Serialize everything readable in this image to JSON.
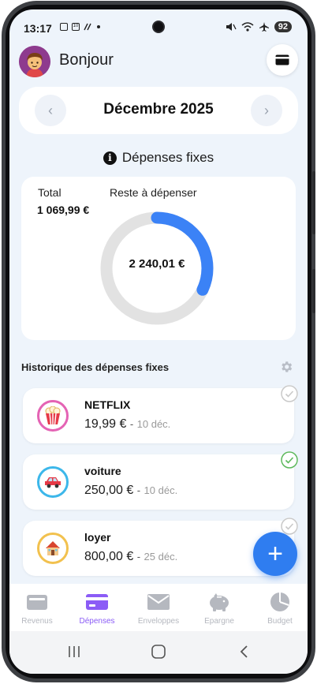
{
  "status_bar": {
    "time": "13:17",
    "mini_box_label": "10",
    "battery": "92"
  },
  "header": {
    "greeting": "Bonjour"
  },
  "month_selector": {
    "month": "Décembre 2025",
    "prev_glyph": "‹",
    "next_glyph": "›"
  },
  "section": {
    "info_glyph": "i",
    "title": "Dépenses fixes"
  },
  "summary": {
    "total_label": "Total",
    "total_value": "1 069,99 €",
    "remaining_label": "Reste à dépenser",
    "remaining_value": "2 240,01 €",
    "remaining_fraction": 0.32,
    "accent_color": "#3b82f6",
    "track_color": "#e2e2e2"
  },
  "history": {
    "title": "Historique des dépenses fixes",
    "items": [
      {
        "name": "NETFLIX",
        "amount": "19,99 €",
        "separator": "-",
        "date": "10 déc.",
        "icon": "popcorn-icon",
        "ring_color": "#e463b4",
        "checked": false
      },
      {
        "name": "voiture",
        "amount": "250,00 €",
        "separator": "-",
        "date": "10 déc.",
        "icon": "car-icon",
        "ring_color": "#3cb7ea",
        "checked": true
      },
      {
        "name": "loyer",
        "amount": "800,00 €",
        "separator": "-",
        "date": "25 déc.",
        "icon": "house-icon",
        "ring_color": "#f2c14e",
        "checked": false
      }
    ]
  },
  "fab": {
    "glyph": "+"
  },
  "bottom_nav": {
    "items": [
      {
        "label": "Revenus",
        "icon": "wallet-icon",
        "active": false
      },
      {
        "label": "Dépenses",
        "icon": "credit-card-icon",
        "active": true
      },
      {
        "label": "Enveloppes",
        "icon": "envelope-icon",
        "active": false
      },
      {
        "label": "Epargne",
        "icon": "piggy-bank-icon",
        "active": false
      },
      {
        "label": "Budget",
        "icon": "pie-chart-icon",
        "active": false
      }
    ],
    "active_color": "#8b5cf6",
    "inactive_color": "#b5b8bf"
  },
  "system_nav": {
    "recents_glyph": "|||",
    "back_glyph": "‹"
  }
}
